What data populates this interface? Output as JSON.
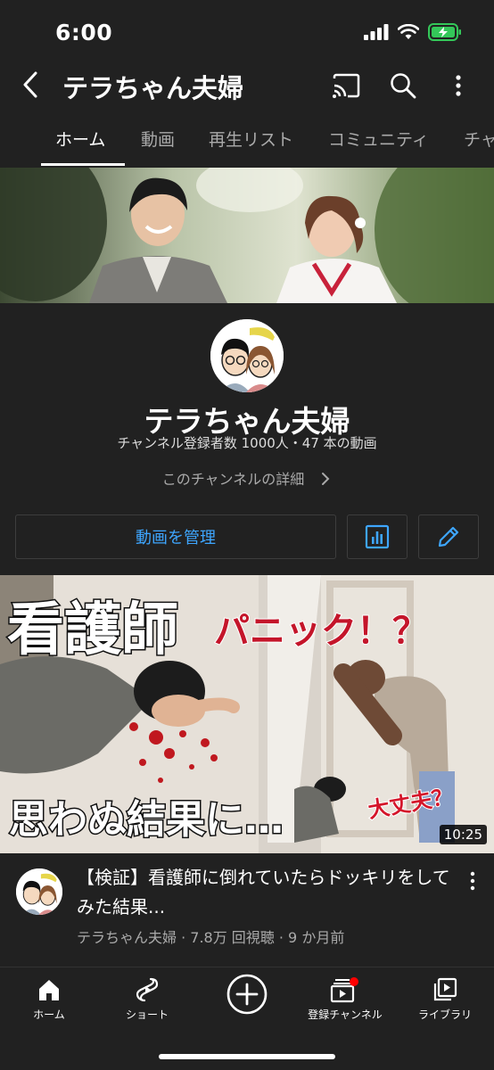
{
  "status_bar": {
    "time": "6:00"
  },
  "header": {
    "title": "テラちゃん夫婦"
  },
  "tabs": [
    {
      "label": "ホーム",
      "active": true
    },
    {
      "label": "動画"
    },
    {
      "label": "再生リスト"
    },
    {
      "label": "コミュニティ"
    },
    {
      "label": "チャ"
    }
  ],
  "channel": {
    "name": "テラちゃん夫婦",
    "stats": "チャンネル登録者数 1000人・47 本の動画",
    "details_link": "このチャンネルの詳細"
  },
  "actions": {
    "manage_label": "動画を管理"
  },
  "video": {
    "thumb_text_1": "看護師",
    "thumb_text_2": "パニック！？",
    "thumb_text_3": "思わぬ結果に…",
    "thumb_text_4": "大丈夫？",
    "duration": "10:25",
    "title": "【検証】看護師に倒れていたらドッキリをしてみた結果...",
    "meta": "テラちゃん夫婦 · 7.8万 回視聴 · 9 か月前"
  },
  "bottom_nav": [
    {
      "label": "ホーム",
      "icon": "home-icon"
    },
    {
      "label": "ショート",
      "icon": "shorts-icon"
    },
    {
      "label": "",
      "icon": "create-icon"
    },
    {
      "label": "登録チャンネル",
      "icon": "subscriptions-icon"
    },
    {
      "label": "ライブラリ",
      "icon": "library-icon"
    }
  ],
  "colors": {
    "background": "#212121",
    "accent_blue": "#3ea6ff",
    "battery_green": "#34c759",
    "notification_red": "#ff0000"
  }
}
